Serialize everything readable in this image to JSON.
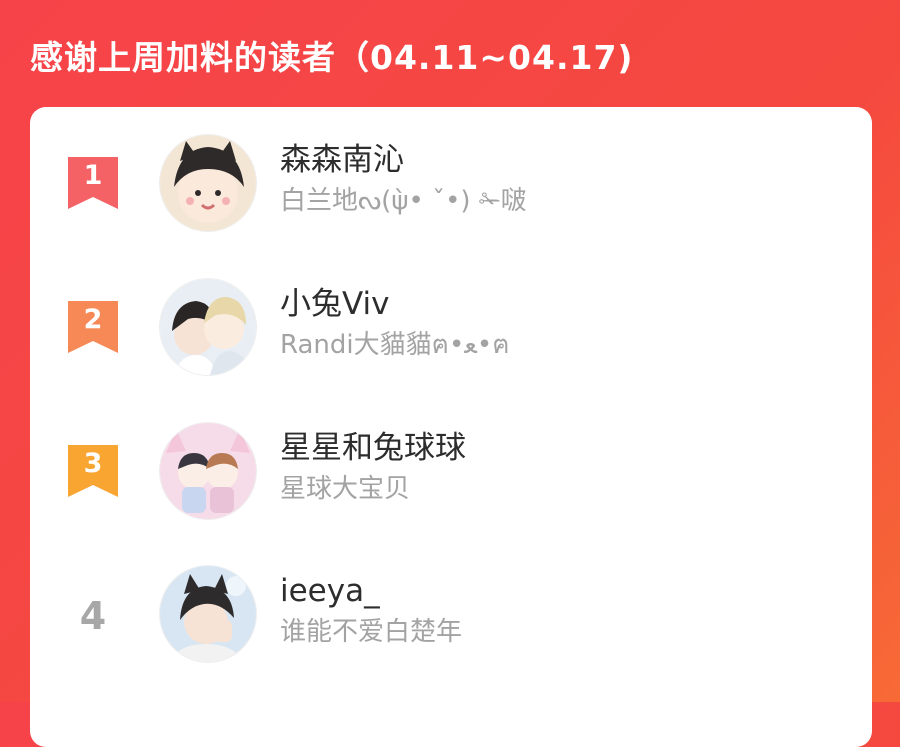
{
  "header": {
    "title": "感谢上周加料的读者（04.11~04.17)"
  },
  "colors": {
    "background": "#f6434a",
    "rank_1": "#f46266",
    "rank_2": "#f78956",
    "rank_3": "#f9a532",
    "rank_4_text": "#a7a7a7"
  },
  "readers": [
    {
      "rank": "1",
      "name": "森森南沁",
      "subtitle": "白兰地ᔓ(ψ̀• ˇ•) ✁啵",
      "avatar_icon": "anime-boy-cat-ears-avatar"
    },
    {
      "rank": "2",
      "name": "小兔Viv",
      "subtitle": "Randi大貓貓ฅ•ﻌ•ฅ",
      "avatar_icon": "two-anime-boys-avatar"
    },
    {
      "rank": "3",
      "name": "星星和兔球球",
      "subtitle": "星球大宝贝",
      "avatar_icon": "chibi-pair-pink-avatar"
    },
    {
      "rank": "4",
      "name": "ieeya_",
      "subtitle": "谁能不爱白楚年",
      "avatar_icon": "anime-boy-cat-ears-blue-avatar"
    }
  ]
}
